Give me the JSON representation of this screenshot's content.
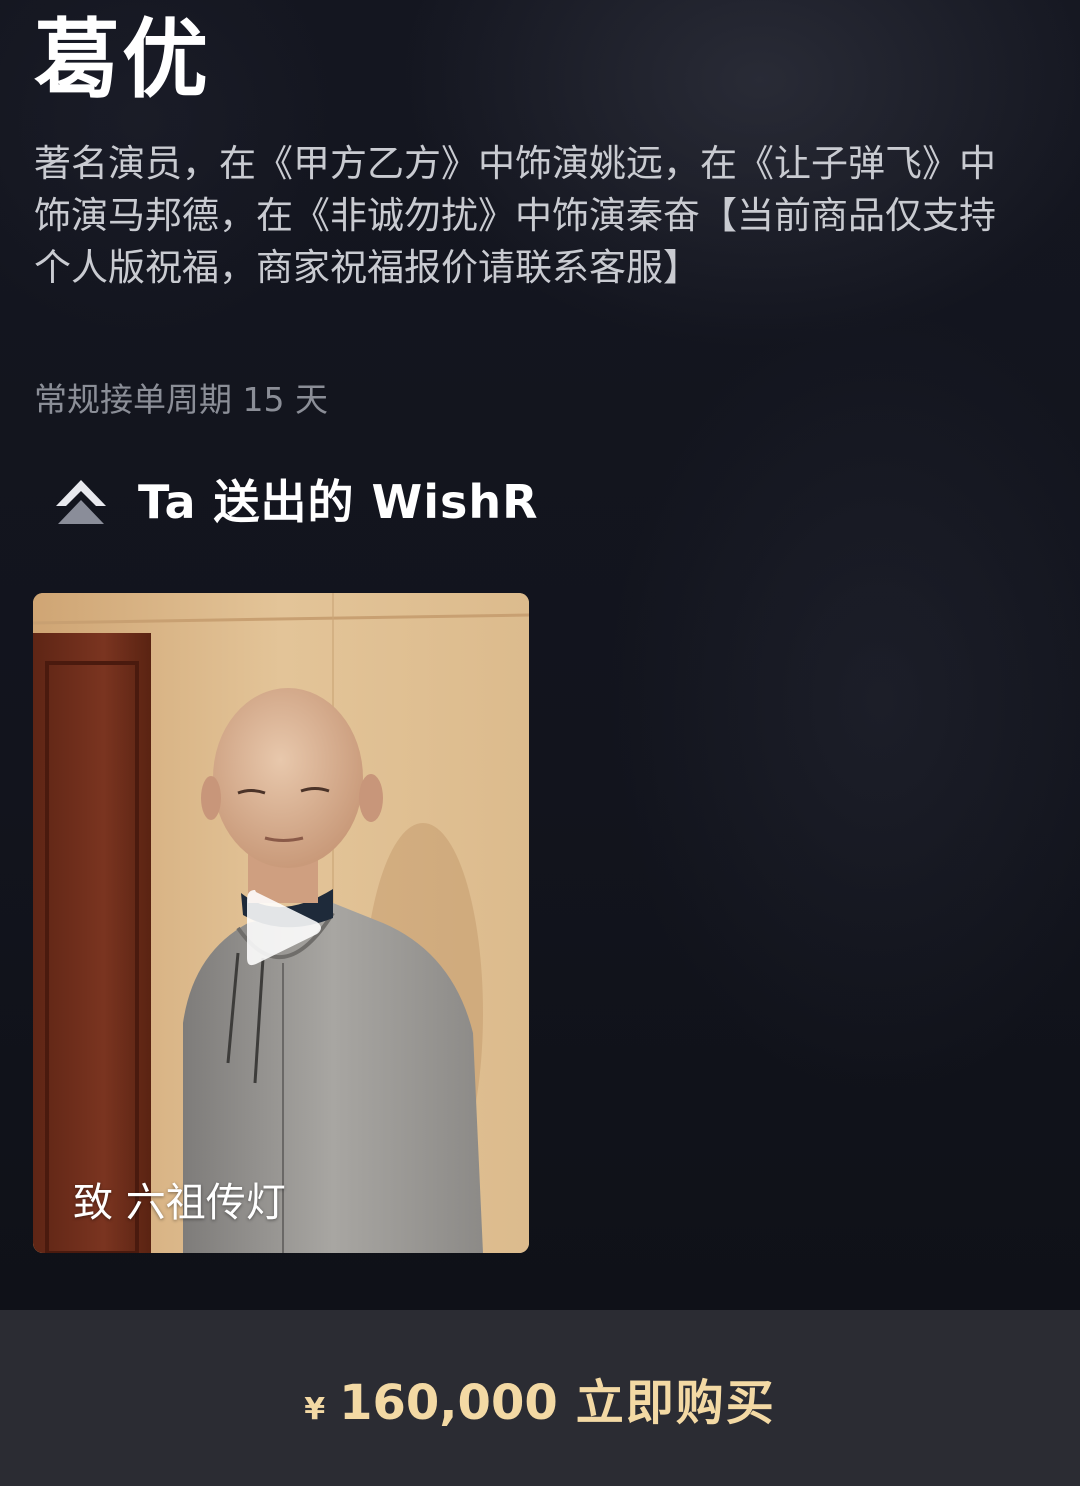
{
  "profile": {
    "name": "葛优",
    "description": "著名演员，在《甲方乙方》中饰演姚远，在《让子弹飞》中饰演马邦德，在《非诚勿扰》中饰演秦奋【当前商品仅支持个人版祝福，商家祝福报价请联系客服】",
    "order_period": "常规接单周期 15 天"
  },
  "wishes_section": {
    "icon": "wishr-logo-icon",
    "title": "Ta 送出的 WishR"
  },
  "video": {
    "caption": "致 六祖传灯",
    "play_icon": "play-icon"
  },
  "buy_bar": {
    "currency": "¥",
    "price": "160,000",
    "label": "立即购买",
    "accent_color": "#f3d9a4",
    "background_color": "#2b2c33"
  }
}
